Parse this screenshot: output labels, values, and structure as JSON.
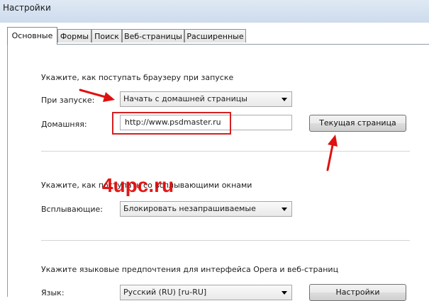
{
  "window": {
    "title": "Настройки"
  },
  "tabs": [
    {
      "label": "Основные",
      "active": true
    },
    {
      "label": "Формы",
      "active": false
    },
    {
      "label": "Поиск",
      "active": false
    },
    {
      "label": "Веб-страницы",
      "active": false
    },
    {
      "label": "Расширенные",
      "active": false
    }
  ],
  "startup": {
    "heading": "Укажите, как поступать браузеру при запуске",
    "startup_label": "При запуске:",
    "startup_value": "Начать с домашней страницы",
    "home_label": "Домашняя:",
    "home_value": "http://www.psdmaster.ru",
    "current_page_button": "Текущая страница"
  },
  "popups": {
    "heading": "Укажите, как поступать со всплывающими окнами",
    "label": "Всплывающие:",
    "value": "Блокировать незапрашиваемые"
  },
  "language": {
    "heading": "Укажите языковые предпочтения для интерфейса Opera и веб-страниц",
    "label": "Язык:",
    "value": "Русский (RU) [ru-RU]",
    "settings_button": "Настройки"
  },
  "watermark": "4upc.ru",
  "colors": {
    "annotation": "#e01010",
    "panel_border": "#8e9aa8"
  }
}
